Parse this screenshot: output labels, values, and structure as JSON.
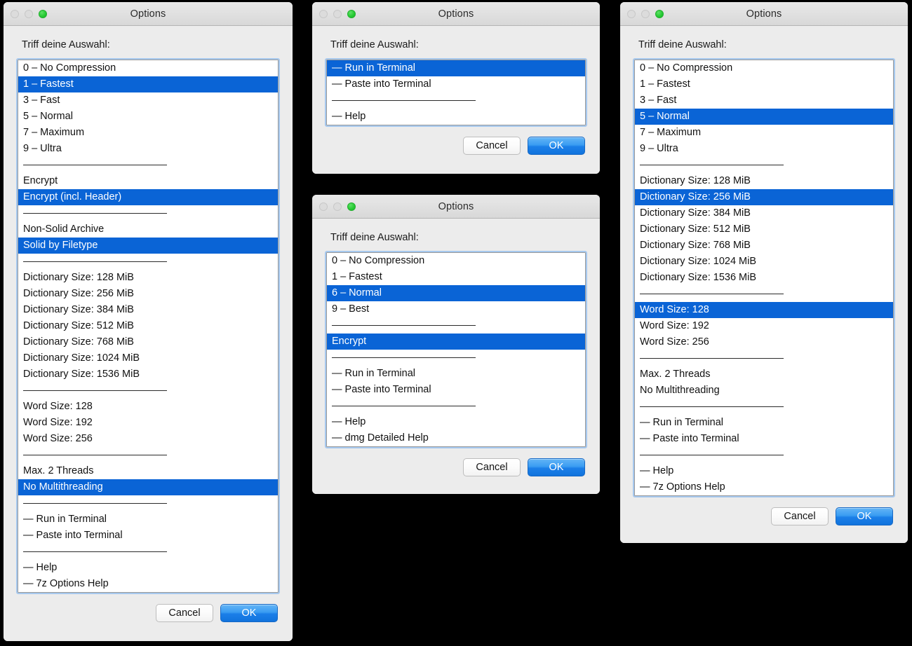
{
  "desktop": {
    "background_color": "#000000"
  },
  "common": {
    "window_title": "Options",
    "prompt": "Triff deine Auswahl:",
    "cancel_label": "Cancel",
    "ok_label": "OK",
    "accent_selection_color": "#0a64d6",
    "ok_button_color": "#1b7fe8",
    "window_background": "#ececec",
    "listbox_background": "#ffffff",
    "focus_ring_color": "#a6c8ee"
  },
  "windows": [
    {
      "id": "win-compress-7z",
      "name": "compression-options-7z",
      "title": "Options",
      "prompt": "Triff deine Auswahl:",
      "items": [
        {
          "label": "0 – No Compression",
          "selected": false,
          "separator": false
        },
        {
          "label": "1 – Fastest",
          "selected": true,
          "separator": false
        },
        {
          "label": "3 – Fast",
          "selected": false,
          "separator": false
        },
        {
          "label": "5 – Normal",
          "selected": false,
          "separator": false
        },
        {
          "label": "7 – Maximum",
          "selected": false,
          "separator": false
        },
        {
          "label": "9 – Ultra",
          "selected": false,
          "separator": false
        },
        {
          "label": "",
          "selected": false,
          "separator": true
        },
        {
          "label": "Encrypt",
          "selected": false,
          "separator": false
        },
        {
          "label": "Encrypt (incl. Header)",
          "selected": true,
          "separator": false
        },
        {
          "label": "",
          "selected": false,
          "separator": true
        },
        {
          "label": "Non-Solid Archive",
          "selected": false,
          "separator": false
        },
        {
          "label": "Solid by Filetype",
          "selected": true,
          "separator": false
        },
        {
          "label": "",
          "selected": false,
          "separator": true
        },
        {
          "label": "Dictionary Size: 128 MiB",
          "selected": false,
          "separator": false
        },
        {
          "label": "Dictionary Size: 256 MiB",
          "selected": false,
          "separator": false
        },
        {
          "label": "Dictionary Size: 384 MiB",
          "selected": false,
          "separator": false
        },
        {
          "label": "Dictionary Size: 512 MiB",
          "selected": false,
          "separator": false
        },
        {
          "label": "Dictionary Size: 768 MiB",
          "selected": false,
          "separator": false
        },
        {
          "label": "Dictionary Size: 1024 MiB",
          "selected": false,
          "separator": false
        },
        {
          "label": "Dictionary Size: 1536 MiB",
          "selected": false,
          "separator": false
        },
        {
          "label": "",
          "selected": false,
          "separator": true
        },
        {
          "label": "Word Size: 128",
          "selected": false,
          "separator": false
        },
        {
          "label": "Word Size: 192",
          "selected": false,
          "separator": false
        },
        {
          "label": "Word Size: 256",
          "selected": false,
          "separator": false
        },
        {
          "label": "",
          "selected": false,
          "separator": true
        },
        {
          "label": "Max. 2 Threads",
          "selected": false,
          "separator": false
        },
        {
          "label": "No Multithreading",
          "selected": true,
          "separator": false
        },
        {
          "label": "",
          "selected": false,
          "separator": true
        },
        {
          "label": "— Run in Terminal",
          "selected": false,
          "separator": false
        },
        {
          "label": "— Paste into Terminal",
          "selected": false,
          "separator": false
        },
        {
          "label": "",
          "selected": false,
          "separator": true
        },
        {
          "label": "— Help",
          "selected": false,
          "separator": false
        },
        {
          "label": "— 7z Options Help",
          "selected": false,
          "separator": false
        }
      ],
      "buttons": {
        "cancel": "Cancel",
        "ok": "OK"
      }
    },
    {
      "id": "win-terminal",
      "name": "terminal-options",
      "title": "Options",
      "prompt": "Triff deine Auswahl:",
      "items": [
        {
          "label": "— Run in Terminal",
          "selected": true,
          "separator": false
        },
        {
          "label": "— Paste into Terminal",
          "selected": false,
          "separator": false
        },
        {
          "label": "",
          "selected": false,
          "separator": true
        },
        {
          "label": "— Help",
          "selected": false,
          "separator": false
        }
      ],
      "buttons": {
        "cancel": "Cancel",
        "ok": "OK"
      }
    },
    {
      "id": "win-dmg",
      "name": "compression-options-dmg",
      "title": "Options",
      "prompt": "Triff deine Auswahl:",
      "items": [
        {
          "label": "0 – No Compression",
          "selected": false,
          "separator": false
        },
        {
          "label": "1 – Fastest",
          "selected": false,
          "separator": false
        },
        {
          "label": "6 – Normal",
          "selected": true,
          "separator": false
        },
        {
          "label": "9 – Best",
          "selected": false,
          "separator": false
        },
        {
          "label": "",
          "selected": false,
          "separator": true
        },
        {
          "label": "Encrypt",
          "selected": true,
          "separator": false
        },
        {
          "label": "",
          "selected": false,
          "separator": true
        },
        {
          "label": "— Run in Terminal",
          "selected": false,
          "separator": false
        },
        {
          "label": "— Paste into Terminal",
          "selected": false,
          "separator": false
        },
        {
          "label": "",
          "selected": false,
          "separator": true
        },
        {
          "label": "— Help",
          "selected": false,
          "separator": false
        },
        {
          "label": "— dmg Detailed Help",
          "selected": false,
          "separator": false
        }
      ],
      "buttons": {
        "cancel": "Cancel",
        "ok": "OK"
      }
    },
    {
      "id": "win-compress-xz",
      "name": "compression-options-xz",
      "title": "Options",
      "prompt": "Triff deine Auswahl:",
      "items": [
        {
          "label": "0 – No Compression",
          "selected": false,
          "separator": false
        },
        {
          "label": "1 – Fastest",
          "selected": false,
          "separator": false
        },
        {
          "label": "3 – Fast",
          "selected": false,
          "separator": false
        },
        {
          "label": "5 – Normal",
          "selected": true,
          "separator": false
        },
        {
          "label": "7 – Maximum",
          "selected": false,
          "separator": false
        },
        {
          "label": "9 – Ultra",
          "selected": false,
          "separator": false
        },
        {
          "label": "",
          "selected": false,
          "separator": true
        },
        {
          "label": "Dictionary Size: 128 MiB",
          "selected": false,
          "separator": false
        },
        {
          "label": "Dictionary Size: 256 MiB",
          "selected": true,
          "separator": false
        },
        {
          "label": "Dictionary Size: 384 MiB",
          "selected": false,
          "separator": false
        },
        {
          "label": "Dictionary Size: 512 MiB",
          "selected": false,
          "separator": false
        },
        {
          "label": "Dictionary Size: 768 MiB",
          "selected": false,
          "separator": false
        },
        {
          "label": "Dictionary Size: 1024 MiB",
          "selected": false,
          "separator": false
        },
        {
          "label": "Dictionary Size: 1536 MiB",
          "selected": false,
          "separator": false
        },
        {
          "label": "",
          "selected": false,
          "separator": true
        },
        {
          "label": "Word Size: 128",
          "selected": true,
          "separator": false
        },
        {
          "label": "Word Size: 192",
          "selected": false,
          "separator": false
        },
        {
          "label": "Word Size: 256",
          "selected": false,
          "separator": false
        },
        {
          "label": "",
          "selected": false,
          "separator": true
        },
        {
          "label": "Max. 2 Threads",
          "selected": false,
          "separator": false
        },
        {
          "label": "No Multithreading",
          "selected": false,
          "separator": false
        },
        {
          "label": "",
          "selected": false,
          "separator": true
        },
        {
          "label": "— Run in Terminal",
          "selected": false,
          "separator": false
        },
        {
          "label": "— Paste into Terminal",
          "selected": false,
          "separator": false
        },
        {
          "label": "",
          "selected": false,
          "separator": true
        },
        {
          "label": "— Help",
          "selected": false,
          "separator": false
        },
        {
          "label": "— 7z Options Help",
          "selected": false,
          "separator": false
        }
      ],
      "buttons": {
        "cancel": "Cancel",
        "ok": "OK"
      }
    }
  ],
  "traffic_lights": [
    {
      "name": "close-button-icon",
      "state": "disabled"
    },
    {
      "name": "minimize-button-icon",
      "state": "disabled"
    },
    {
      "name": "zoom-button-icon",
      "state": "enabled"
    }
  ]
}
